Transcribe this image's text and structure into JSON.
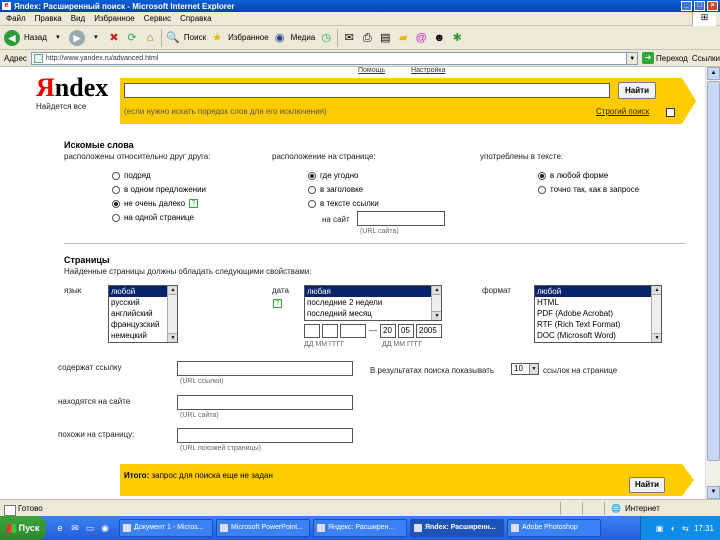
{
  "window": {
    "title": "Яndex: Расширенный поиск - Microsoft Internet Explorer",
    "controls": [
      "_",
      "□",
      "×"
    ]
  },
  "menubar": {
    "items": [
      "Файл",
      "Правка",
      "Вид",
      "Избранное",
      "Сервис",
      "Справка"
    ]
  },
  "toolbar": {
    "back_label": "Назад",
    "search_label": "Поиск",
    "favorites_label": "Избранное",
    "media_label": "Медиа"
  },
  "address": {
    "label": "Адрес",
    "url": "http://www.yandex.ru/advanced.html",
    "go_label": "Переход",
    "links_label": "Ссылки"
  },
  "page": {
    "top_links": [
      "Помощь",
      "Настройка"
    ],
    "logo_ya": "Я",
    "logo_rest": "ndex",
    "logo_sub": "Найдется все",
    "find_button": "Найти",
    "hint": "(если нужно искать порядок слов для его исключения)",
    "search_all": "Строгий поиск",
    "words_section": {
      "title": "Искомые слова",
      "col1_head": "расположены относительно друг друга:",
      "col2_head": "расположение на странице:",
      "col3_head": "употреблены в тексте:",
      "col1": [
        "подряд",
        "в одном предложении",
        "не очень далеко",
        "на одной странице"
      ],
      "col2": [
        "где угодно",
        "в заголовке",
        "в тексте ссылки"
      ],
      "col3": [
        "в любой форме",
        "точно так, как в запросе"
      ],
      "site_label": "на сайт",
      "site_hint": "(URL сайта)"
    },
    "pages_section": {
      "title": "Страницы",
      "subtitle": "Найденные страницы должны обладать следующими свойствами:",
      "lang_label": "язык",
      "languages": [
        "любой",
        "русский",
        "английский",
        "французский",
        "немецкий"
      ],
      "date_label": "дата",
      "dates": [
        "любая",
        "последние 2 недели",
        "последний месяц"
      ],
      "date_from_sep": "—",
      "date_day2": "20",
      "date_month2": "05",
      "date_year2": "2005",
      "date_hint_from": "ДД ММ ГГГГ",
      "date_hint_to": "ДД ММ ГГГГ",
      "format_label": "формат",
      "formats": [
        "любой",
        "HTML",
        "PDF (Adobe Acrobat)",
        "RTF (Rich Text Format)",
        "DOC (Microsoft Word)"
      ]
    },
    "contains_link_label": "содержат ссылку",
    "contains_link_hint": "(URL ссылки)",
    "on_site_label": "находятся на сайте",
    "on_site_hint": "(URL сайта)",
    "similar_label": "похожи на страницу:",
    "similar_hint": "(URL похожей страницы)",
    "results_prefix": "В результатах поиска показывать",
    "results_count": "10",
    "results_suffix": "ссылок на странице",
    "itogo_label": "Итого:",
    "itogo_text": "запрос для поиска еще не задан"
  },
  "status": {
    "left": "Готово",
    "zone": "Интернет"
  },
  "taskbar": {
    "start": "Пуск",
    "tasks": [
      "Документ 1 - Micros...",
      "Microsoft PowerPoint...",
      "Яндекс: Расширен...",
      "Яndex: Расширенн...",
      "Adobe Photoshop"
    ],
    "clock": "17:31"
  }
}
